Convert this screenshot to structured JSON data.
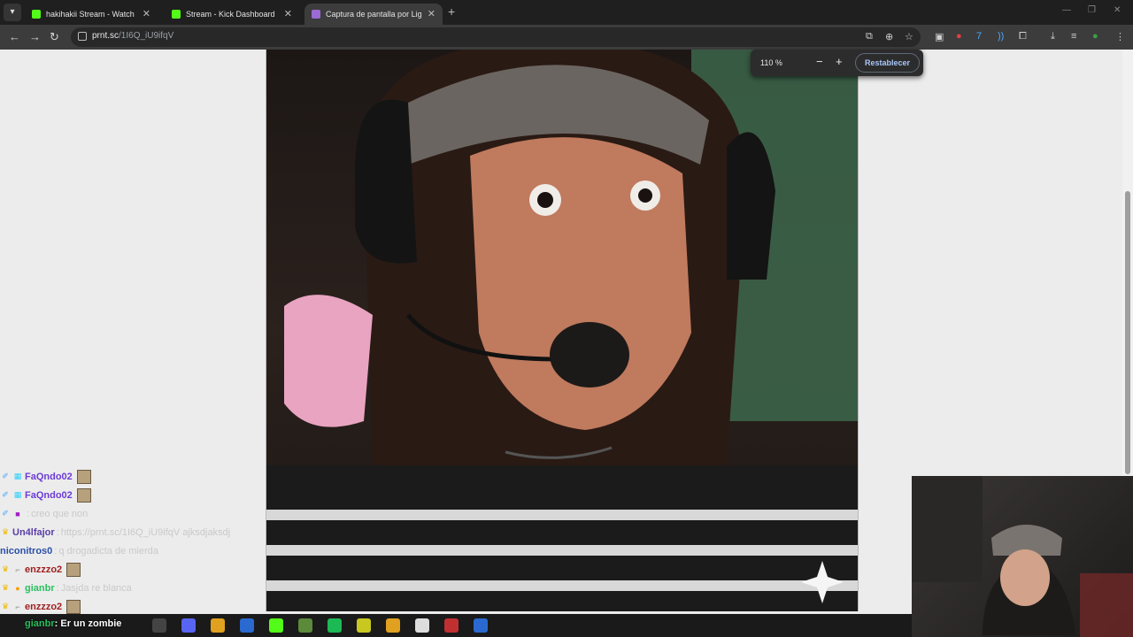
{
  "browser": {
    "tabs": [
      {
        "label": "hakihakii Stream - Watch Live o",
        "icon": "kick-logo-icon",
        "color": "#53fc18"
      },
      {
        "label": "Stream - Kick Dashboard",
        "icon": "kick-logo-icon",
        "color": "#53fc18"
      },
      {
        "label": "Captura de pantalla por Lightsh",
        "icon": "lightshot-feather-icon",
        "color": "#9c6ad3"
      }
    ],
    "url_host": "prnt.sc",
    "url_path": "/1I6Q_iU9ifqV",
    "zoom": {
      "value": "110 %",
      "minus": "−",
      "plus": "+",
      "reset": "Restablecer"
    }
  },
  "chat": [
    {
      "badges": [
        "✐",
        "▦"
      ],
      "badge_colors": [
        "#4aa8ff",
        "#2fd0ff"
      ],
      "user": "FaQndo02",
      "user_color": "#6c3cd6",
      "message": "",
      "emote": true
    },
    {
      "badges": [
        "✐",
        "▦"
      ],
      "badge_colors": [
        "#4aa8ff",
        "#2fd0ff"
      ],
      "user": "FaQndo02",
      "user_color": "#6c3cd6",
      "message": "",
      "emote": true
    },
    {
      "badges": [
        "✐",
        "■"
      ],
      "badge_colors": [
        "#4aa8ff",
        "#a020c0"
      ],
      "user": "",
      "user_color": "#3fb7d6",
      "message": "creo que non",
      "emote": false
    },
    {
      "badges": [
        "♛"
      ],
      "badge_colors": [
        "#f0b800"
      ],
      "user": "Un4lfajor",
      "user_color": "#5a3da8",
      "message": "https://prnt.sc/1I6Q_iU9ifqV ajksdjaksdj",
      "emote": false
    },
    {
      "badges": [],
      "badge_colors": [],
      "user": "niconitros0",
      "user_color": "#2a4fa8",
      "message": "q drogadicta de mierda",
      "emote": false
    },
    {
      "badges": [
        "♛",
        "⌐"
      ],
      "badge_colors": [
        "#f0b800",
        "#888888"
      ],
      "user": "enzzzo2",
      "user_color": "#a02020",
      "message": "",
      "emote": true
    },
    {
      "badges": [
        "♛",
        "●"
      ],
      "badge_colors": [
        "#f0b800",
        "#f0a000"
      ],
      "user": "gianbr",
      "user_color": "#2ac060",
      "message": "Jasjda re blanca",
      "emote": false
    },
    {
      "badges": [
        "♛",
        "⌐"
      ],
      "badge_colors": [
        "#f0b800",
        "#888888"
      ],
      "user": "enzzzo2",
      "user_color": "#a02020",
      "message": "",
      "emote": true
    }
  ],
  "overlay_message": {
    "user": "gianbr",
    "text": "Er un zombie"
  },
  "taskbar": {
    "apps": [
      {
        "icon": "obs-icon",
        "color": "#444444"
      },
      {
        "icon": "discord-icon",
        "color": "#5865f2"
      },
      {
        "icon": "chrome-icon",
        "color": "#e0a020"
      },
      {
        "icon": "ccleaner-icon",
        "color": "#2a6ad0"
      },
      {
        "icon": "kick-icon",
        "color": "#53fc18"
      },
      {
        "icon": "minecraft-icon",
        "color": "#5a8a3a"
      },
      {
        "icon": "spotify-icon",
        "color": "#1db954"
      },
      {
        "icon": "game-icon",
        "color": "#c8c820"
      },
      {
        "icon": "chrome-icon",
        "color": "#e0a020"
      },
      {
        "icon": "settings-gear-icon",
        "color": "#dddddd"
      },
      {
        "icon": "voicemeeter-icon",
        "color": "#c03030"
      },
      {
        "icon": "ccleaner-icon",
        "color": "#2a6ad0"
      }
    ]
  }
}
